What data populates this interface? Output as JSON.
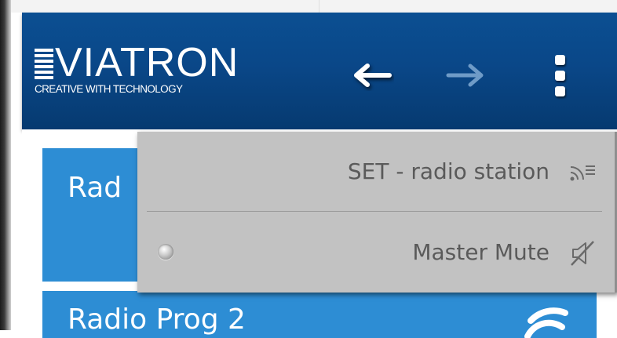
{
  "brand": {
    "name": "VIATRON",
    "tagline": "CREATIVE WITH TECHNOLOGY"
  },
  "header": {
    "back_icon": "arrow-left-icon",
    "forward_icon": "arrow-right-icon",
    "menu_icon": "vertical-dots-icon"
  },
  "tiles": [
    {
      "label": "Rad"
    },
    {
      "label": "Radio Prog 2",
      "icon": "wifi-icon"
    }
  ],
  "dropdown": {
    "items": [
      {
        "label": "SET - radio station",
        "icon": "radio-station-icon"
      },
      {
        "label": "Master Mute",
        "icon": "mute-icon",
        "selected": false
      }
    ]
  },
  "colors": {
    "header": "#0a4788",
    "tile": "#2d8dd4",
    "dropdown": "#c2c2c2",
    "menu_text": "#5a5a5a"
  }
}
